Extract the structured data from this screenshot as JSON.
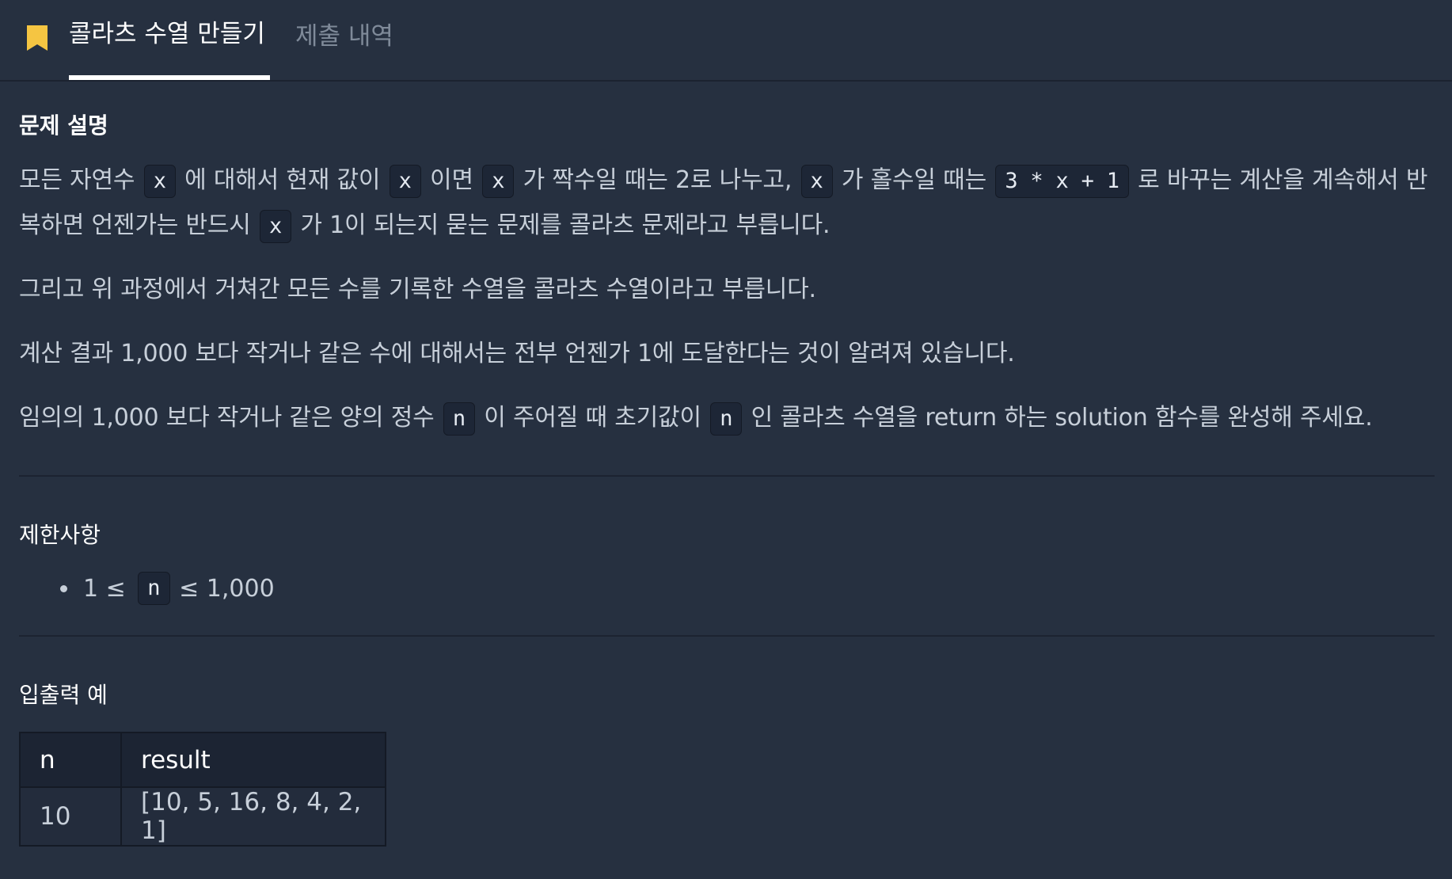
{
  "tabs": {
    "active": "콜라츠 수열 만들기",
    "inactive": "제출 내역"
  },
  "colors": {
    "background": "#263040",
    "accent_bookmark": "#f5c542",
    "code_background": "#1d2636"
  },
  "description": {
    "title": "문제 설명",
    "p1": {
      "t1": "모든 자연수 ",
      "c1": "x",
      "t2": " 에 대해서 현재 값이 ",
      "c2": "x",
      "t3": " 이면 ",
      "c3": "x",
      "t4": " 가 짝수일 때는 2로 나누고, ",
      "c4": "x",
      "t5": " 가 홀수일 때는 ",
      "c5": "3 * x + 1",
      "t6": " 로 바꾸는 계산을 계속해서 반복하면 언젠가는 반드시 ",
      "c6": "x",
      "t7": " 가 1이 되는지 묻는 문제를 콜라츠 문제라고 부릅니다."
    },
    "p2": "그리고 위 과정에서 거쳐간 모든 수를 기록한 수열을 콜라츠 수열이라고 부릅니다.",
    "p3": "계산 결과 1,000 보다 작거나 같은 수에 대해서는 전부 언젠가 1에 도달한다는 것이 알려져 있습니다.",
    "p4": {
      "t1": "임의의 1,000 보다 작거나 같은 양의 정수 ",
      "c1": "n",
      "t2": " 이 주어질 때 초기값이 ",
      "c2": "n",
      "t3": " 인 콜라츠 수열을 return 하는 solution 함수를 완성해 주세요."
    }
  },
  "constraints": {
    "title": "제한사항",
    "item1": {
      "before": "1 ≤ ",
      "code": "n",
      "after": " ≤ 1,000"
    }
  },
  "examples": {
    "title": "입출력 예",
    "headers": [
      "n",
      "result"
    ],
    "rows": [
      [
        "10",
        "[10, 5, 16, 8, 4, 2, 1]"
      ]
    ]
  }
}
